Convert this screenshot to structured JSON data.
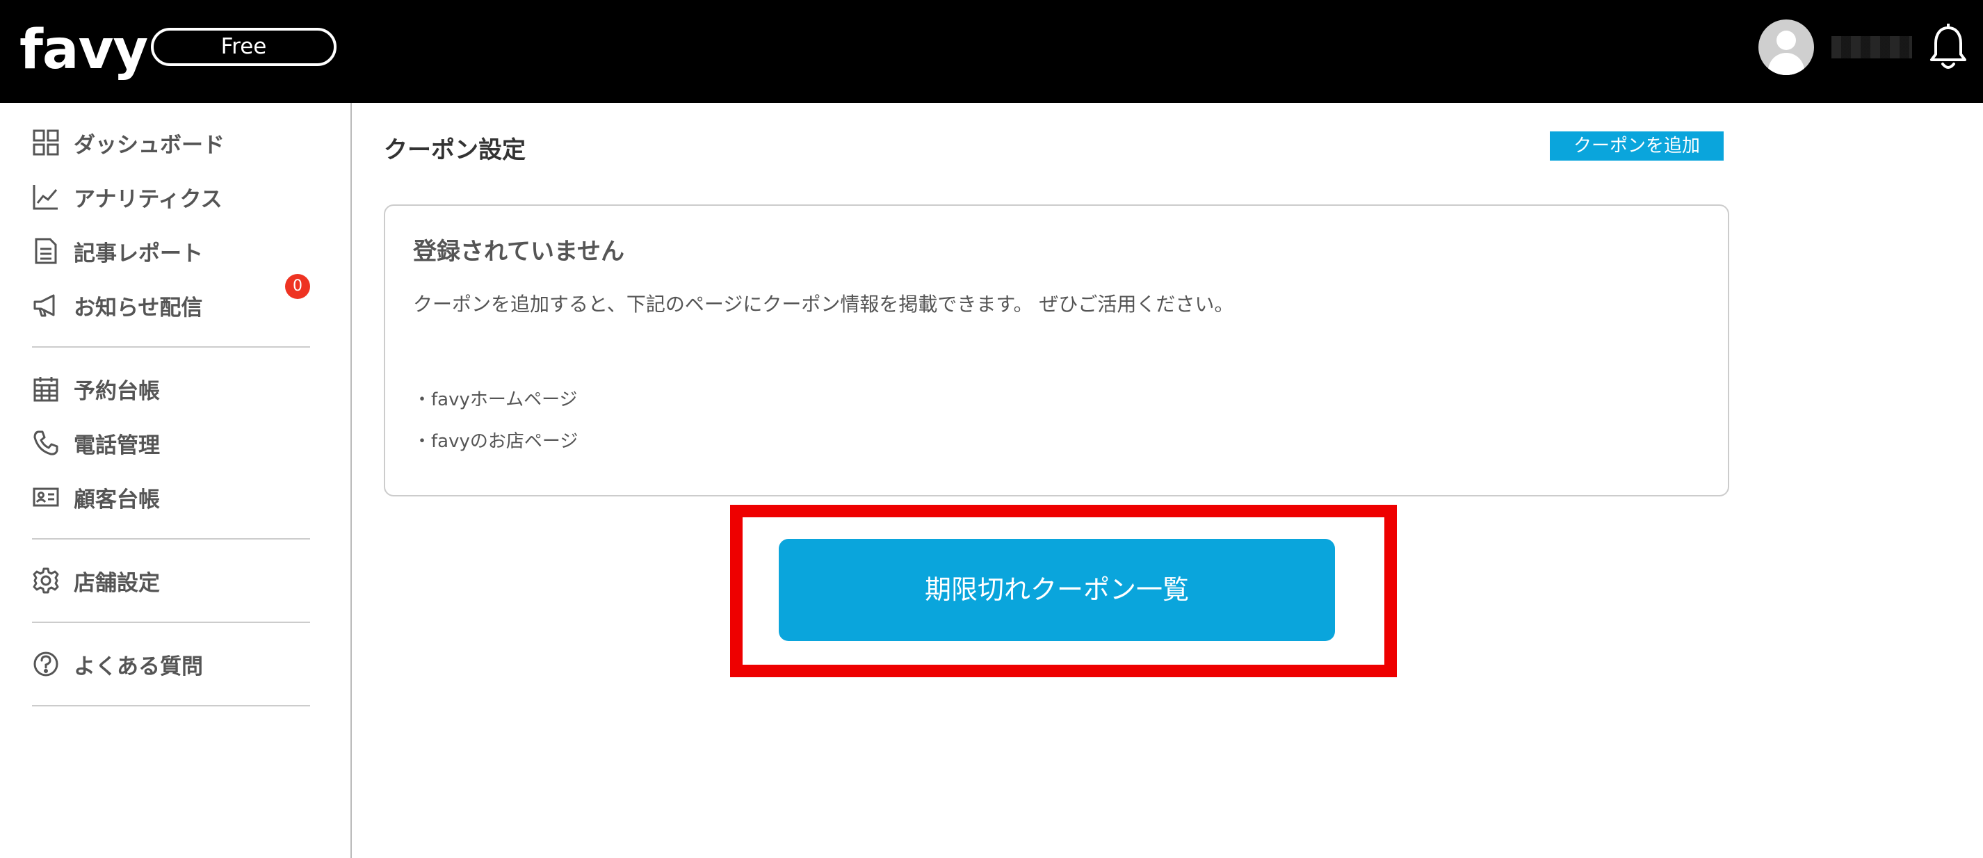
{
  "header": {
    "logo": "favy",
    "plan": "Free",
    "icons": {
      "avatar": "user-avatar-icon",
      "notifications": "bell-icon"
    }
  },
  "sidebar": {
    "items": [
      {
        "label": "ダッシュボード",
        "icon": "grid-icon"
      },
      {
        "label": "アナリティクス",
        "icon": "line-chart-icon"
      },
      {
        "label": "記事レポート",
        "icon": "document-icon"
      },
      {
        "label": "お知らせ配信",
        "icon": "megaphone-icon"
      },
      {
        "label": "予約台帳",
        "icon": "calendar-icon",
        "badge": "0"
      },
      {
        "label": "電話管理",
        "icon": "phone-icon"
      },
      {
        "label": "顧客台帳",
        "icon": "id-card-icon"
      },
      {
        "label": "店舗設定",
        "icon": "gear-icon"
      },
      {
        "label": "よくある質問",
        "icon": "question-icon"
      }
    ]
  },
  "main": {
    "title": "クーポン設定",
    "add_button": "クーポンを追加",
    "card": {
      "heading": "登録されていません",
      "description": "クーポンを追加すると、下記のページにクーポン情報を掲載できます。 ぜひご活用ください。",
      "list": [
        "・favyホームページ",
        "・favyのお店ページ"
      ]
    },
    "expired_button": "期限切れクーポン一覧"
  },
  "colors": {
    "accent": "#0aa5dc",
    "highlight": "#ee0000",
    "badge": "#ee3322",
    "header_bg": "#000000"
  }
}
